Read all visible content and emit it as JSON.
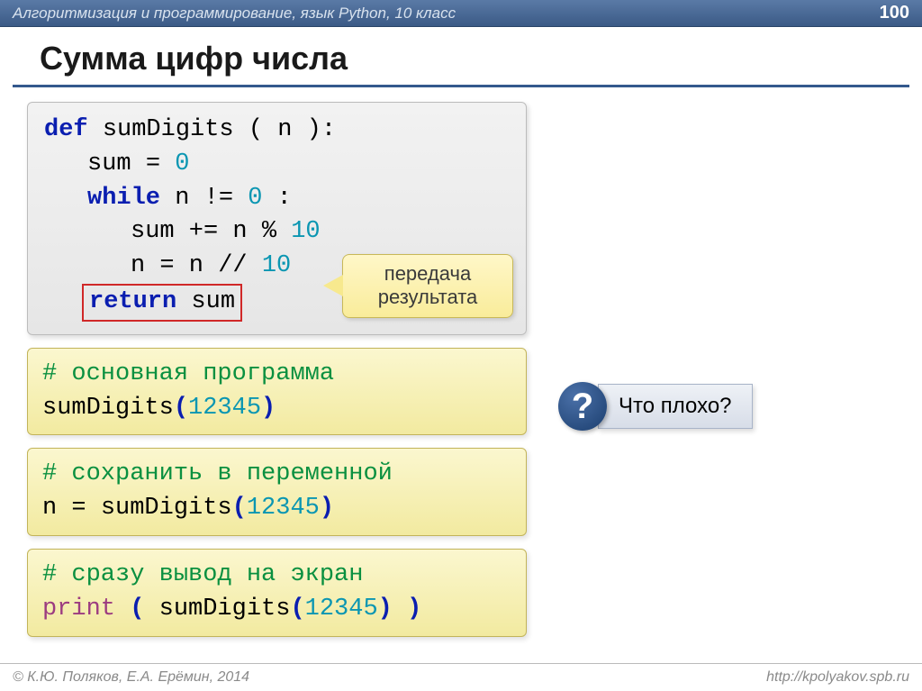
{
  "header": {
    "breadcrumb": "Алгоритмизация и программирование, язык Python, 10 класс",
    "page_number": "100"
  },
  "title": "Сумма цифр числа",
  "code": {
    "def": "def",
    "fn_name": "sumDigits",
    "sig_open": "( n ):",
    "l2a": "sum",
    "l2b": "=",
    "l2c": "0",
    "while": "while",
    "l3b": "n != ",
    "l3c": "0",
    "l3d": ":",
    "l4a": "sum += n %",
    "l4b": "10",
    "l5a": "n = n //",
    "l5b": "10",
    "return": "return",
    "ret_val": "sum"
  },
  "callout": {
    "line1": "передача",
    "line2": "результата"
  },
  "box1": {
    "comment": "# основная программа",
    "fn": "sumDigits",
    "open": "(",
    "arg": "12345",
    "close": ")"
  },
  "box2": {
    "comment": "# сохранить в переменной",
    "lhs": "n = ",
    "fn": "sumDigits",
    "open": "(",
    "arg": "12345",
    "close": ")"
  },
  "box3": {
    "comment": "# сразу вывод на экран",
    "print": "print",
    "open1": " ( ",
    "fn": "sumDigits",
    "open2": "(",
    "arg": "12345",
    "close2": ")",
    "close1": " )"
  },
  "question": {
    "mark": "?",
    "text": "Что плохо?"
  },
  "footer": {
    "left": "© К.Ю. Поляков, Е.А. Ерёмин, 2014",
    "right": "http://kpolyakov.spb.ru"
  }
}
